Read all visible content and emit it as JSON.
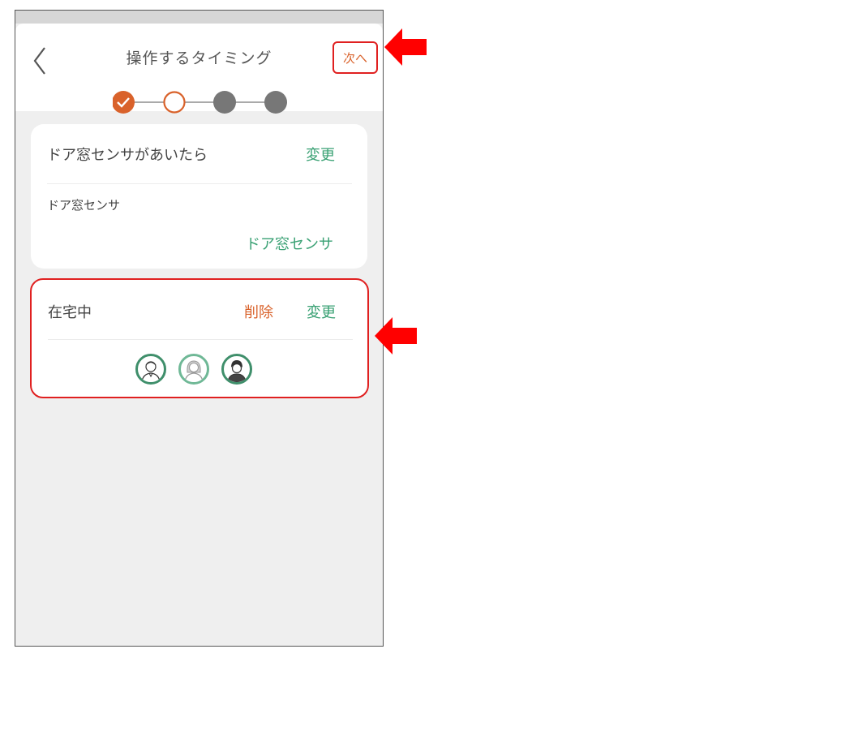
{
  "header": {
    "title": "操作するタイミング",
    "next_label": "次へ"
  },
  "stepper": {
    "steps": [
      "done",
      "current",
      "pending",
      "pending"
    ]
  },
  "trigger_card": {
    "title": "ドア窓センサがあいたら",
    "change_label": "変更",
    "device_label": "ドア窓センサ",
    "device_value": "ドア窓センサ"
  },
  "condition_card": {
    "title": "在宅中",
    "delete_label": "削除",
    "change_label": "変更",
    "members": [
      "man-avatar-icon",
      "woman-avatar-icon",
      "boy-avatar-icon"
    ]
  },
  "colors": {
    "accent_orange": "#d9622b",
    "accent_green": "#3aa174",
    "highlight_red": "#e02020",
    "step_pending": "#777777"
  }
}
